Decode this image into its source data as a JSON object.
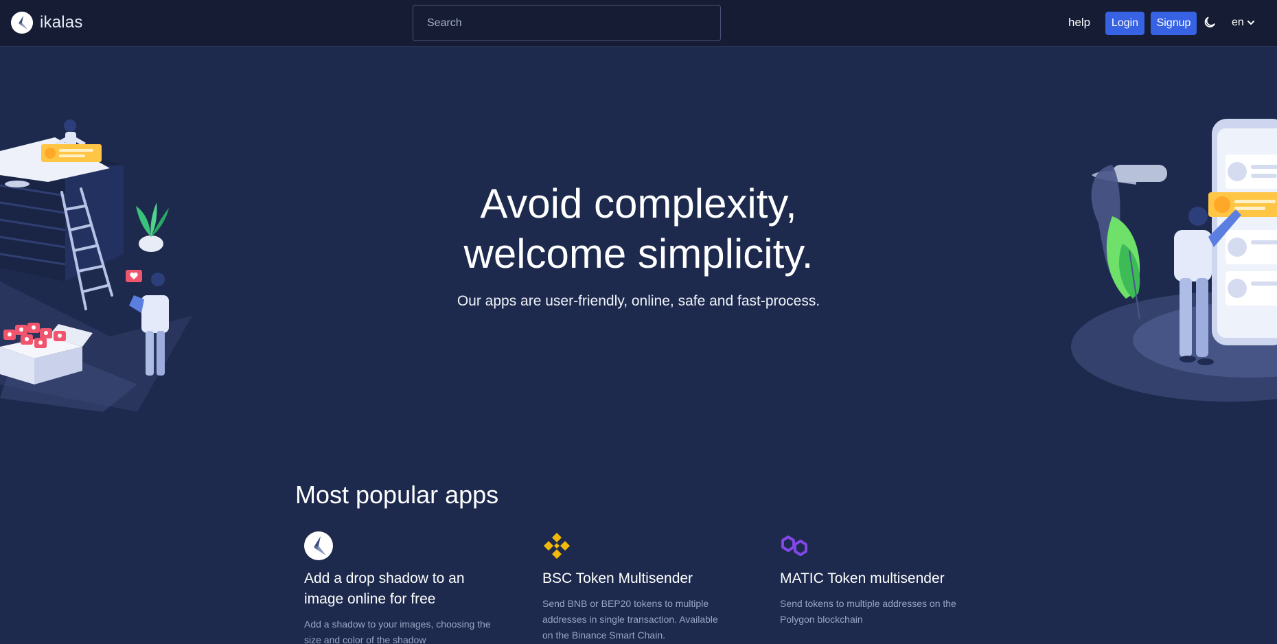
{
  "nav": {
    "brand": "ikalas",
    "search_placeholder": "Search",
    "help": "help",
    "login": "Login",
    "signup": "Signup",
    "language": "en"
  },
  "hero": {
    "title_line1": "Avoid complexity,",
    "title_line2": "welcome simplicity.",
    "subtitle": "Our apps are user-friendly, online, safe and fast-process."
  },
  "popular": {
    "title": "Most popular apps",
    "apps": [
      {
        "icon": "ikalas-logo-icon",
        "title": "Add a drop shadow to an image online for free",
        "description": "Add a shadow to your images, choosing the size and color of the shadow"
      },
      {
        "icon": "binance-icon",
        "title": "BSC Token Multisender",
        "description": "Send BNB or BEP20 tokens to multiple addresses in single transaction. Available on the Binance Smart Chain."
      },
      {
        "icon": "polygon-icon",
        "title": "MATIC Token multisender",
        "description": "Send tokens to multiple addresses on the Polygon blockchain"
      }
    ]
  },
  "colors": {
    "background": "#1d2a4d",
    "navbar": "#151c33",
    "primary_button": "#3662e3",
    "binance": "#f0b90b",
    "polygon": "#8247e5"
  }
}
